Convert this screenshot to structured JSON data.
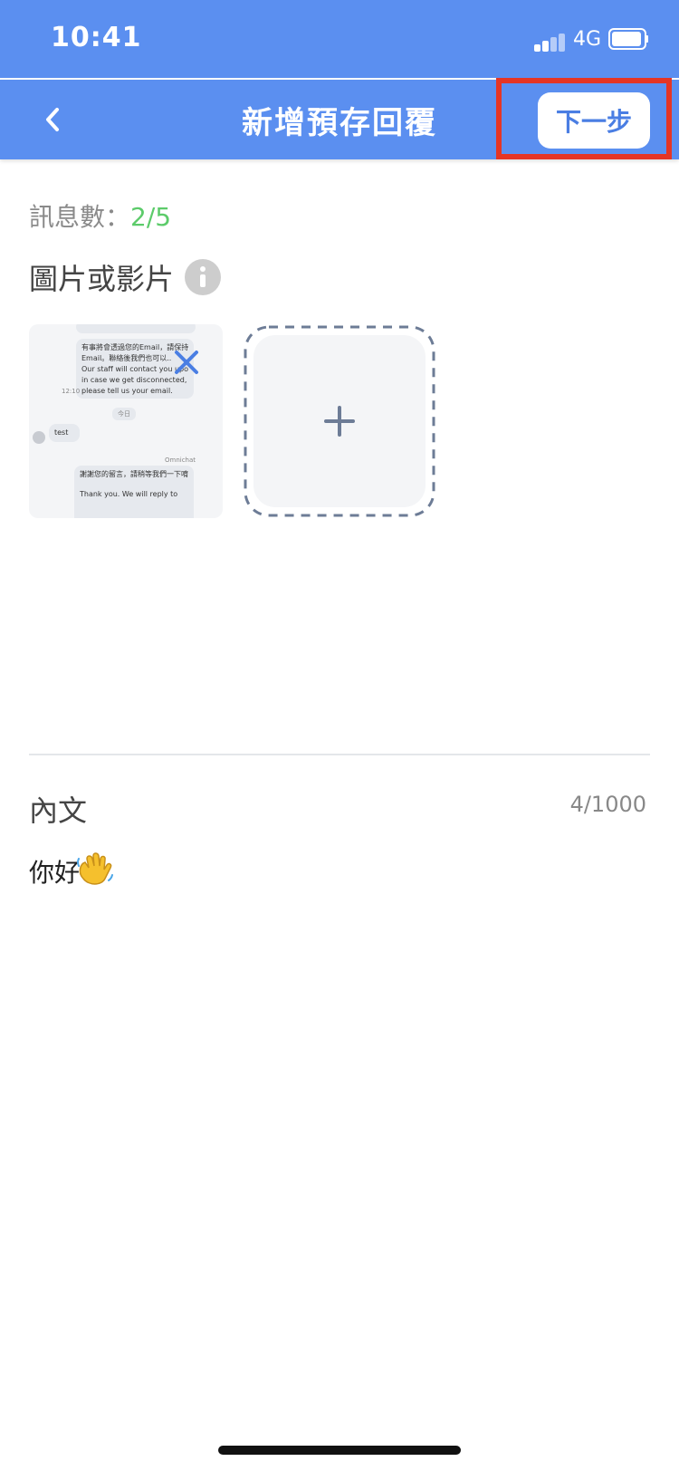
{
  "status_bar": {
    "time": "10:41",
    "network": "4G"
  },
  "nav": {
    "title": "新增預存回覆",
    "next_label": "下一步"
  },
  "message_count": {
    "label": "訊息數：",
    "value": "2/5"
  },
  "media": {
    "title": "圖片或影片",
    "thumbnail_lines": [
      "有事將會透過您的Email，請保持聯繫",
      "Email。聯絡後我們也可以..",
      "Our staff will contact you upon",
      "in case we get disconnected,",
      "please tell us your email.",
      "test",
      "Omnichat",
      "謝謝您的留言，請稍等我們一下唷",
      "Thank you. We will reply to"
    ]
  },
  "body": {
    "label": "內文",
    "char_count": "4/1000",
    "text": "你好"
  },
  "colors": {
    "brand": "#5b8ff0",
    "accent_green": "#5ccb6a",
    "highlight": "#e53525"
  }
}
